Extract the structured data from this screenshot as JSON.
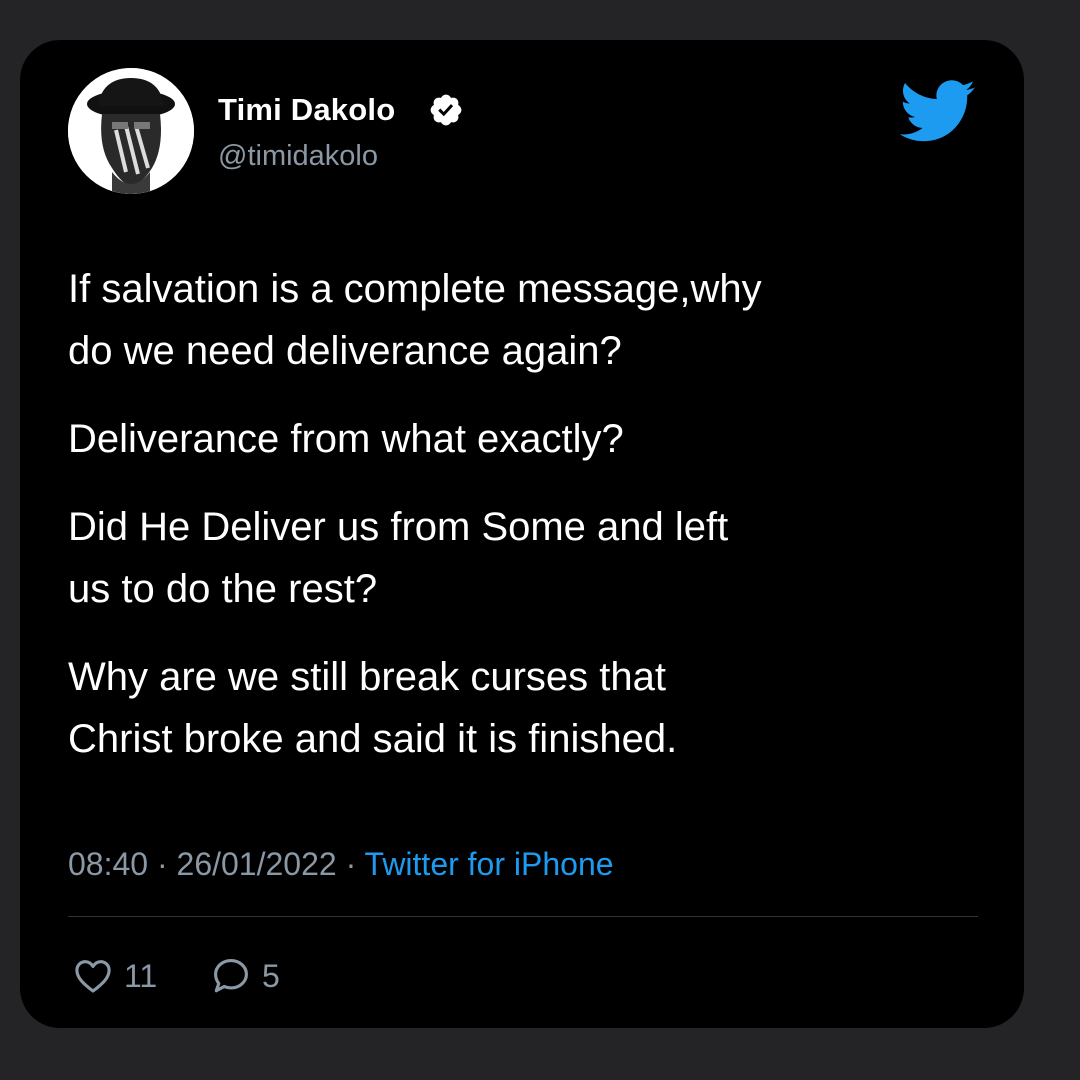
{
  "author": {
    "display_name": "Timi Dakolo",
    "handle": "@timidakolo",
    "verified": true
  },
  "tweet": {
    "paragraphs": [
      "If salvation is a complete message,why\ndo we need deliverance again?",
      "Deliverance from what exactly?",
      "Did He Deliver us from Some and left\nus to do the rest?",
      "Why are we still break curses that\nChrist broke and said it is finished."
    ],
    "time": "08:40",
    "date": "26/01/2022",
    "source": "Twitter for iPhone"
  },
  "engagement": {
    "likes": "11",
    "replies": "5"
  },
  "icons": {
    "brand": "twitter-bird-icon",
    "verified": "verified-badge-icon",
    "like": "heart-icon",
    "reply": "speech-bubble-icon"
  },
  "colors": {
    "background": "#242426",
    "card": "#000000",
    "text": "#ffffff",
    "secondary_text": "#8b98a5",
    "twitter_blue": "#1d9bf0"
  }
}
